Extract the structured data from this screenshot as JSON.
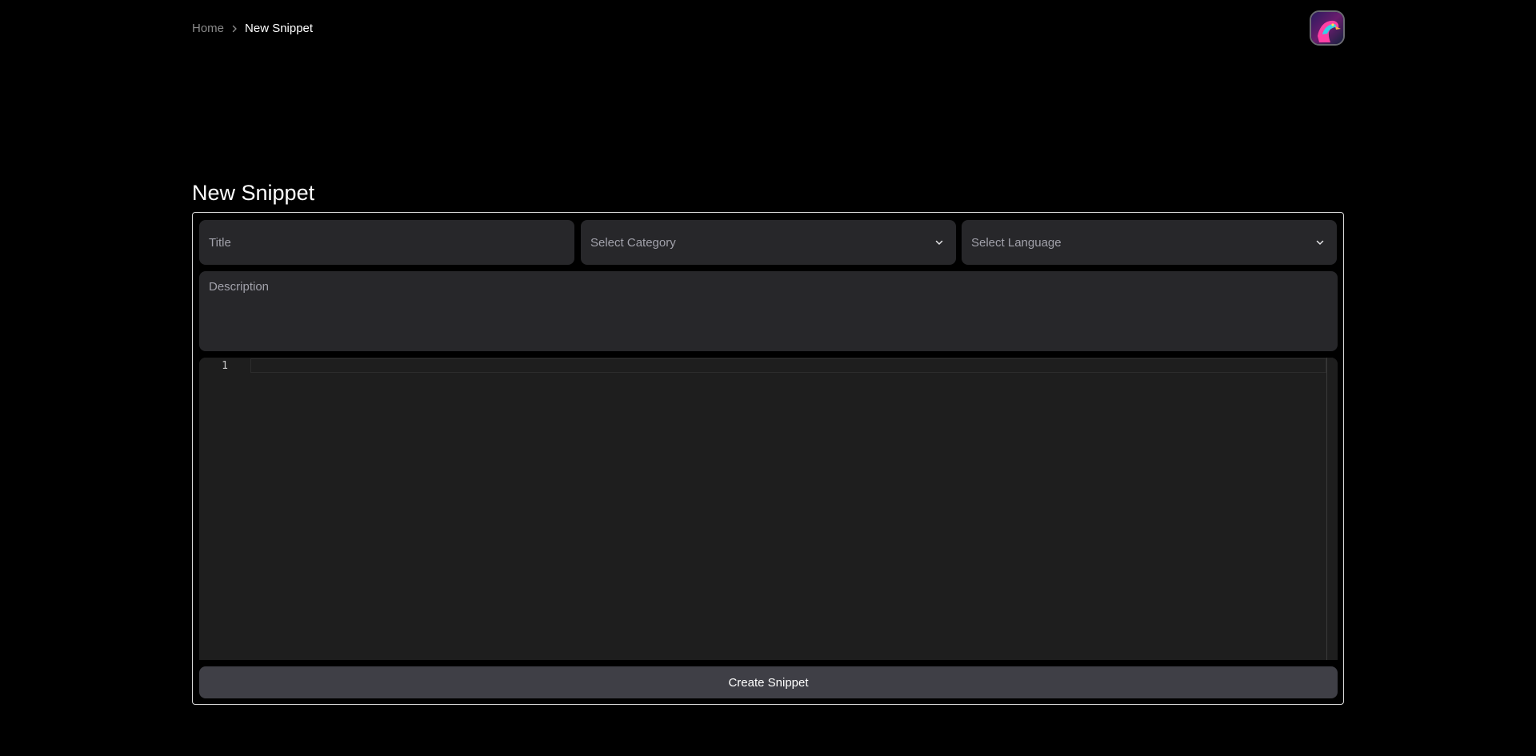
{
  "breadcrumb": {
    "home_label": "Home",
    "current_label": "New Snippet",
    "separator_icon": "chevron-right-icon"
  },
  "header": {
    "avatar_icon": "user-avatar"
  },
  "page": {
    "title": "New Snippet"
  },
  "form": {
    "title_placeholder": "Title",
    "title_value": "",
    "category_select": {
      "selected_label": "Select Category",
      "icon": "chevron-down-icon"
    },
    "language_select": {
      "selected_label": "Select Language",
      "icon": "chevron-down-icon"
    },
    "description_placeholder": "Description",
    "description_value": "",
    "editor": {
      "line_numbers": [
        "1"
      ],
      "code": ""
    },
    "submit_label": "Create Snippet"
  },
  "colors": {
    "background": "#000000",
    "field_background": "#27272a",
    "editor_background": "#1e1e1e",
    "button_background": "#3f3f46",
    "card_border": "#d9d9d9",
    "muted_text": "#a1a1aa"
  }
}
